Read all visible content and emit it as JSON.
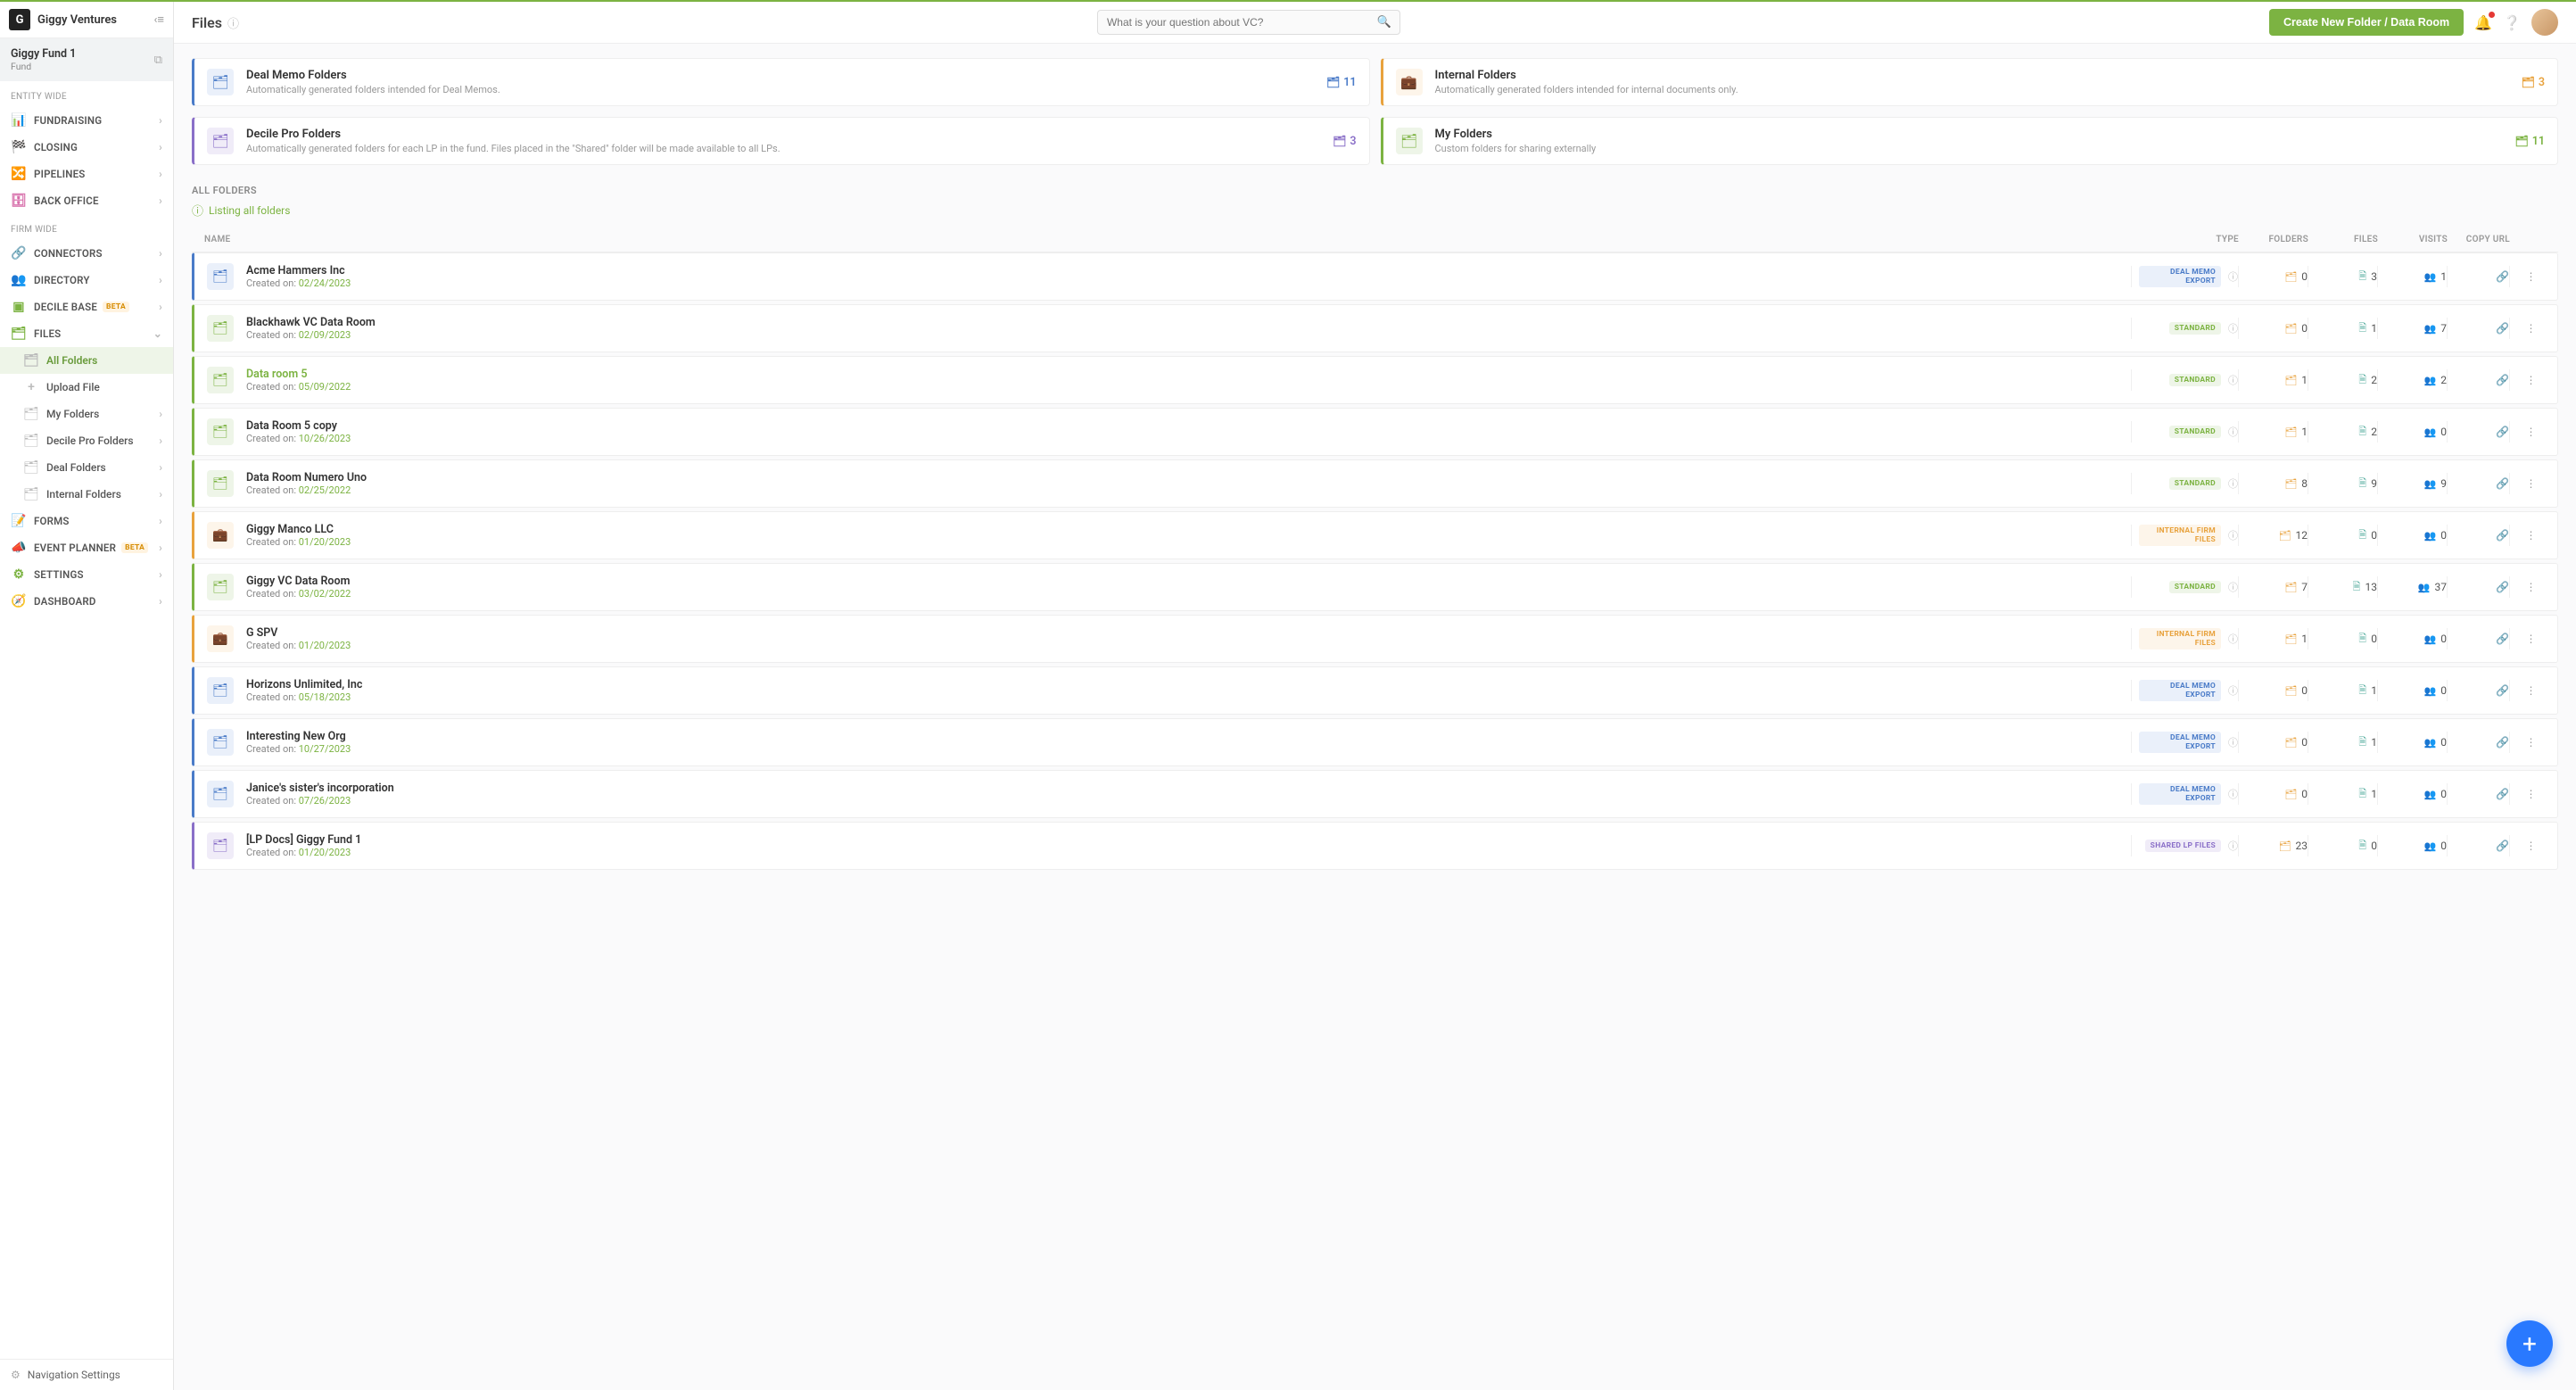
{
  "header": {
    "company": "Giggy Ventures",
    "logo_letter": "G"
  },
  "fund": {
    "name": "Giggy Fund 1",
    "type": "Fund"
  },
  "sidebar": {
    "section_entity": "ENTITY WIDE",
    "section_firm": "FIRM WIDE",
    "entity_items": [
      {
        "label": "FUNDRAISING",
        "icon": "📊",
        "color": "#d66aa8"
      },
      {
        "label": "CLOSING",
        "icon": "🏁",
        "color": "#d66aa8"
      },
      {
        "label": "PIPELINES",
        "icon": "🔀",
        "color": "#d66aa8"
      },
      {
        "label": "BACK OFFICE",
        "icon": "🗄",
        "color": "#d66aa8"
      }
    ],
    "firm_items_top": [
      {
        "label": "CONNECTORS",
        "icon": "🔗",
        "color": "#7cb342"
      },
      {
        "label": "DIRECTORY",
        "icon": "👥",
        "color": "#7cb342"
      },
      {
        "label": "DECILE BASE",
        "icon": "▣",
        "color": "#7cb342",
        "beta": true
      },
      {
        "label": "FILES",
        "icon": "🗂",
        "color": "#7cb342",
        "expanded": true
      }
    ],
    "files_sub": [
      {
        "label": "All Folders",
        "icon": "🗂",
        "active": true
      },
      {
        "label": "Upload File",
        "icon": "+",
        "active": false
      },
      {
        "label": "My Folders",
        "icon": "🗂",
        "chev": true
      },
      {
        "label": "Decile Pro Folders",
        "icon": "🗂",
        "chev": true
      },
      {
        "label": "Deal Folders",
        "icon": "🗂",
        "chev": true
      },
      {
        "label": "Internal Folders",
        "icon": "🗂",
        "chev": true
      }
    ],
    "firm_items_bottom": [
      {
        "label": "FORMS",
        "icon": "📝",
        "color": "#7cb342"
      },
      {
        "label": "EVENT PLANNER",
        "icon": "📣",
        "color": "#7cb342",
        "beta": true
      },
      {
        "label": "SETTINGS",
        "icon": "⚙",
        "color": "#7cb342",
        "chev": true
      },
      {
        "label": "DASHBOARD",
        "icon": "🧭",
        "color": "#7cb342"
      }
    ],
    "footer": "Navigation Settings"
  },
  "topbar": {
    "title": "Files",
    "search_placeholder": "What is your question about VC?",
    "create_button": "Create New Folder / Data Room"
  },
  "categories": [
    {
      "title": "Deal Memo Folders",
      "desc": "Automatically generated folders intended for Deal Memos.",
      "count": 11,
      "theme": "blue",
      "icon": "🗂"
    },
    {
      "title": "Internal Folders",
      "desc": "Automatically generated folders intended for internal documents only.",
      "count": 3,
      "theme": "orange",
      "icon": "💼"
    },
    {
      "title": "Decile Pro Folders",
      "desc": "Automatically generated folders for each LP in the fund. Files placed in the \"Shared\" folder will be made available to all LPs.",
      "count": 3,
      "theme": "purple",
      "icon": "🗂"
    },
    {
      "title": "My Folders",
      "desc": "Custom folders for sharing externally",
      "count": 11,
      "theme": "green",
      "icon": "🗂"
    }
  ],
  "all_folders": {
    "heading": "ALL FOLDERS",
    "listing": "Listing all folders",
    "created_on_label": "Created on:",
    "columns": {
      "name": "NAME",
      "type": "TYPE",
      "folders": "FOLDERS",
      "files": "FILES",
      "visits": "VISITS",
      "copy": "COPY URL"
    },
    "rows": [
      {
        "name": "Acme Hammers Inc",
        "date": "02/24/2023",
        "type": "DEAL MEMO EXPORT",
        "type_theme": "blue",
        "theme": "blue",
        "folders": 0,
        "files": 3,
        "visits": 1
      },
      {
        "name": "Blackhawk VC Data Room",
        "date": "02/09/2023",
        "type": "STANDARD",
        "type_theme": "green",
        "theme": "green",
        "folders": 0,
        "files": 1,
        "visits": 7
      },
      {
        "name": "Data room 5",
        "date": "05/09/2022",
        "type": "STANDARD",
        "type_theme": "green",
        "theme": "green",
        "folders": 1,
        "files": 2,
        "visits": 2,
        "name_link": true
      },
      {
        "name": "Data Room 5 copy",
        "date": "10/26/2023",
        "type": "STANDARD",
        "type_theme": "green",
        "theme": "green",
        "folders": 1,
        "files": 2,
        "visits": 0
      },
      {
        "name": "Data Room Numero Uno",
        "date": "02/25/2022",
        "type": "STANDARD",
        "type_theme": "green",
        "theme": "green",
        "folders": 8,
        "files": 9,
        "visits": 9
      },
      {
        "name": "Giggy Manco LLC",
        "date": "01/20/2023",
        "type": "INTERNAL FIRM FILES",
        "type_theme": "orange",
        "theme": "orange",
        "folders": 12,
        "files": 0,
        "visits": 0
      },
      {
        "name": "Giggy VC Data Room",
        "date": "03/02/2022",
        "type": "STANDARD",
        "type_theme": "green",
        "theme": "green",
        "folders": 7,
        "files": 13,
        "visits": 37
      },
      {
        "name": "G SPV",
        "date": "01/20/2023",
        "type": "INTERNAL FIRM FILES",
        "type_theme": "orange",
        "theme": "orange",
        "folders": 1,
        "files": 0,
        "visits": 0
      },
      {
        "name": "Horizons Unlimited, Inc",
        "date": "05/18/2023",
        "type": "DEAL MEMO EXPORT",
        "type_theme": "blue",
        "theme": "blue",
        "folders": 0,
        "files": 1,
        "visits": 0
      },
      {
        "name": "Interesting New Org",
        "date": "10/27/2023",
        "type": "DEAL MEMO EXPORT",
        "type_theme": "blue",
        "theme": "blue",
        "folders": 0,
        "files": 1,
        "visits": 0
      },
      {
        "name": "Janice's sister's incorporation",
        "date": "07/26/2023",
        "type": "DEAL MEMO EXPORT",
        "type_theme": "blue",
        "theme": "blue",
        "folders": 0,
        "files": 1,
        "visits": 0
      },
      {
        "name": "[LP Docs] Giggy Fund 1",
        "date": "01/20/2023",
        "type": "SHARED LP FILES",
        "type_theme": "purple",
        "theme": "purple",
        "folders": 23,
        "files": 0,
        "visits": 0
      }
    ]
  },
  "colors": {
    "blue": {
      "fg": "#4a7bc8",
      "bg": "#eaf0fa"
    },
    "orange": {
      "fg": "#e8a23d",
      "bg": "#fdf5ea"
    },
    "purple": {
      "fg": "#8a6fc8",
      "bg": "#f0ecf8"
    },
    "green": {
      "fg": "#7cb342",
      "bg": "#eef5e8"
    },
    "teal": {
      "fg": "#4ca89a"
    }
  },
  "beta_label": "BETA"
}
